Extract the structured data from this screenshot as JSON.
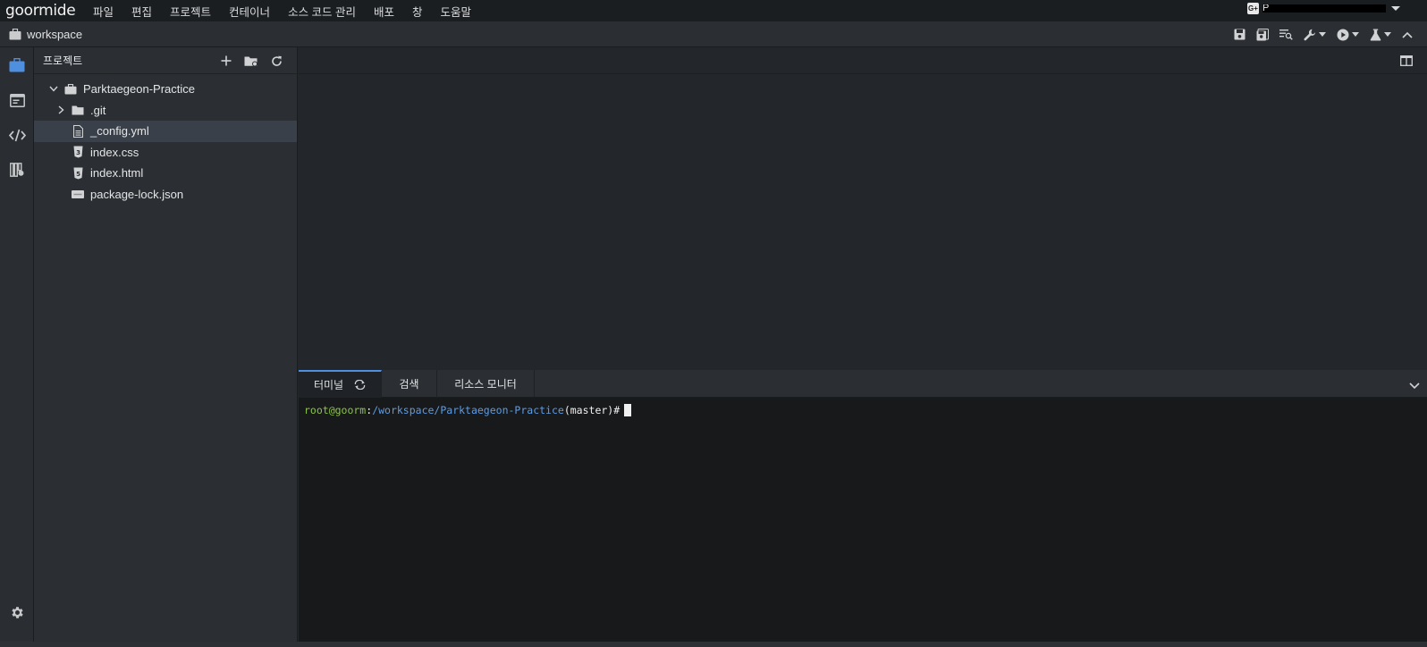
{
  "app": {
    "logo": "goormide"
  },
  "menu": [
    "파일",
    "편집",
    "프로젝트",
    "컨테이너",
    "소스 코드 관리",
    "배포",
    "창",
    "도움말"
  ],
  "account": {
    "badge": "G+",
    "name": "P"
  },
  "toolbar": {
    "workspace_label": "workspace",
    "icons": [
      "save-icon",
      "save-all-icon",
      "find-icon",
      "wrench-icon",
      "run-icon",
      "flask-icon",
      "collapse-up-icon"
    ]
  },
  "activity_bar": [
    "project-icon",
    "terminal-window-icon",
    "code-icon",
    "library-icon",
    "settings-icon"
  ],
  "sidebar": {
    "title": "프로젝트",
    "tree": [
      {
        "label": "Parktaegeon-Practice",
        "type": "project",
        "expanded": true,
        "level": 0
      },
      {
        "label": ".git",
        "type": "folder",
        "expanded": false,
        "level": 1
      },
      {
        "label": "_config.yml",
        "type": "file",
        "level": 1,
        "selected": true
      },
      {
        "label": "index.css",
        "type": "css",
        "level": 1
      },
      {
        "label": "index.html",
        "type": "html",
        "level": 1
      },
      {
        "label": "package-lock.json",
        "type": "json",
        "level": 1
      }
    ]
  },
  "bottom_panel": {
    "tabs": [
      "터미널",
      "검색",
      "리소스 모니터"
    ],
    "active_tab": "터미널",
    "terminal": {
      "user": "root@goorm",
      "sep": ":",
      "path": "/workspace/Parktaegeon-Practice",
      "branch": "(master)#"
    }
  },
  "colors": {
    "accent": "#4e8fe0",
    "terminal_user": "#8bc34a",
    "terminal_path": "#5d9ce6"
  }
}
